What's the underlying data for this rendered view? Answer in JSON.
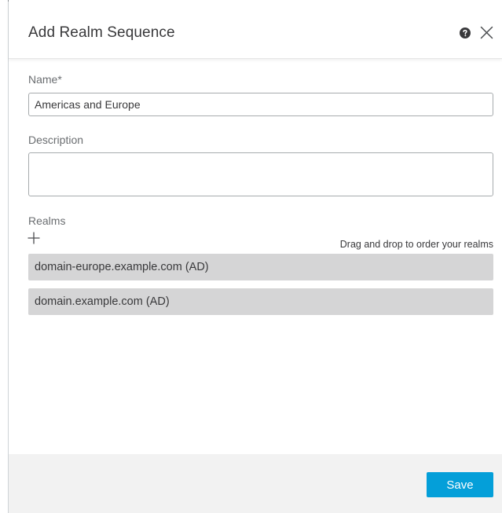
{
  "dialog": {
    "title": "Add Realm Sequence",
    "help_icon": "question-circle-icon",
    "close_icon": "close-x-icon"
  },
  "form": {
    "name_label": "Name*",
    "name_value": "Americas and Europe",
    "description_label": "Description",
    "description_value": "",
    "realms_label": "Realms",
    "add_icon": "plus-icon",
    "drag_hint": "Drag and drop to order your realms",
    "realms": [
      "domain-europe.example.com (AD)",
      "domain.example.com (AD)"
    ]
  },
  "footer": {
    "save_label": "Save"
  },
  "colors": {
    "accent": "#049fd9",
    "realm_item_bg": "#d5d5d6",
    "footer_bg": "#f2f2f2",
    "text": "#39393b",
    "label": "#6a6d70"
  }
}
